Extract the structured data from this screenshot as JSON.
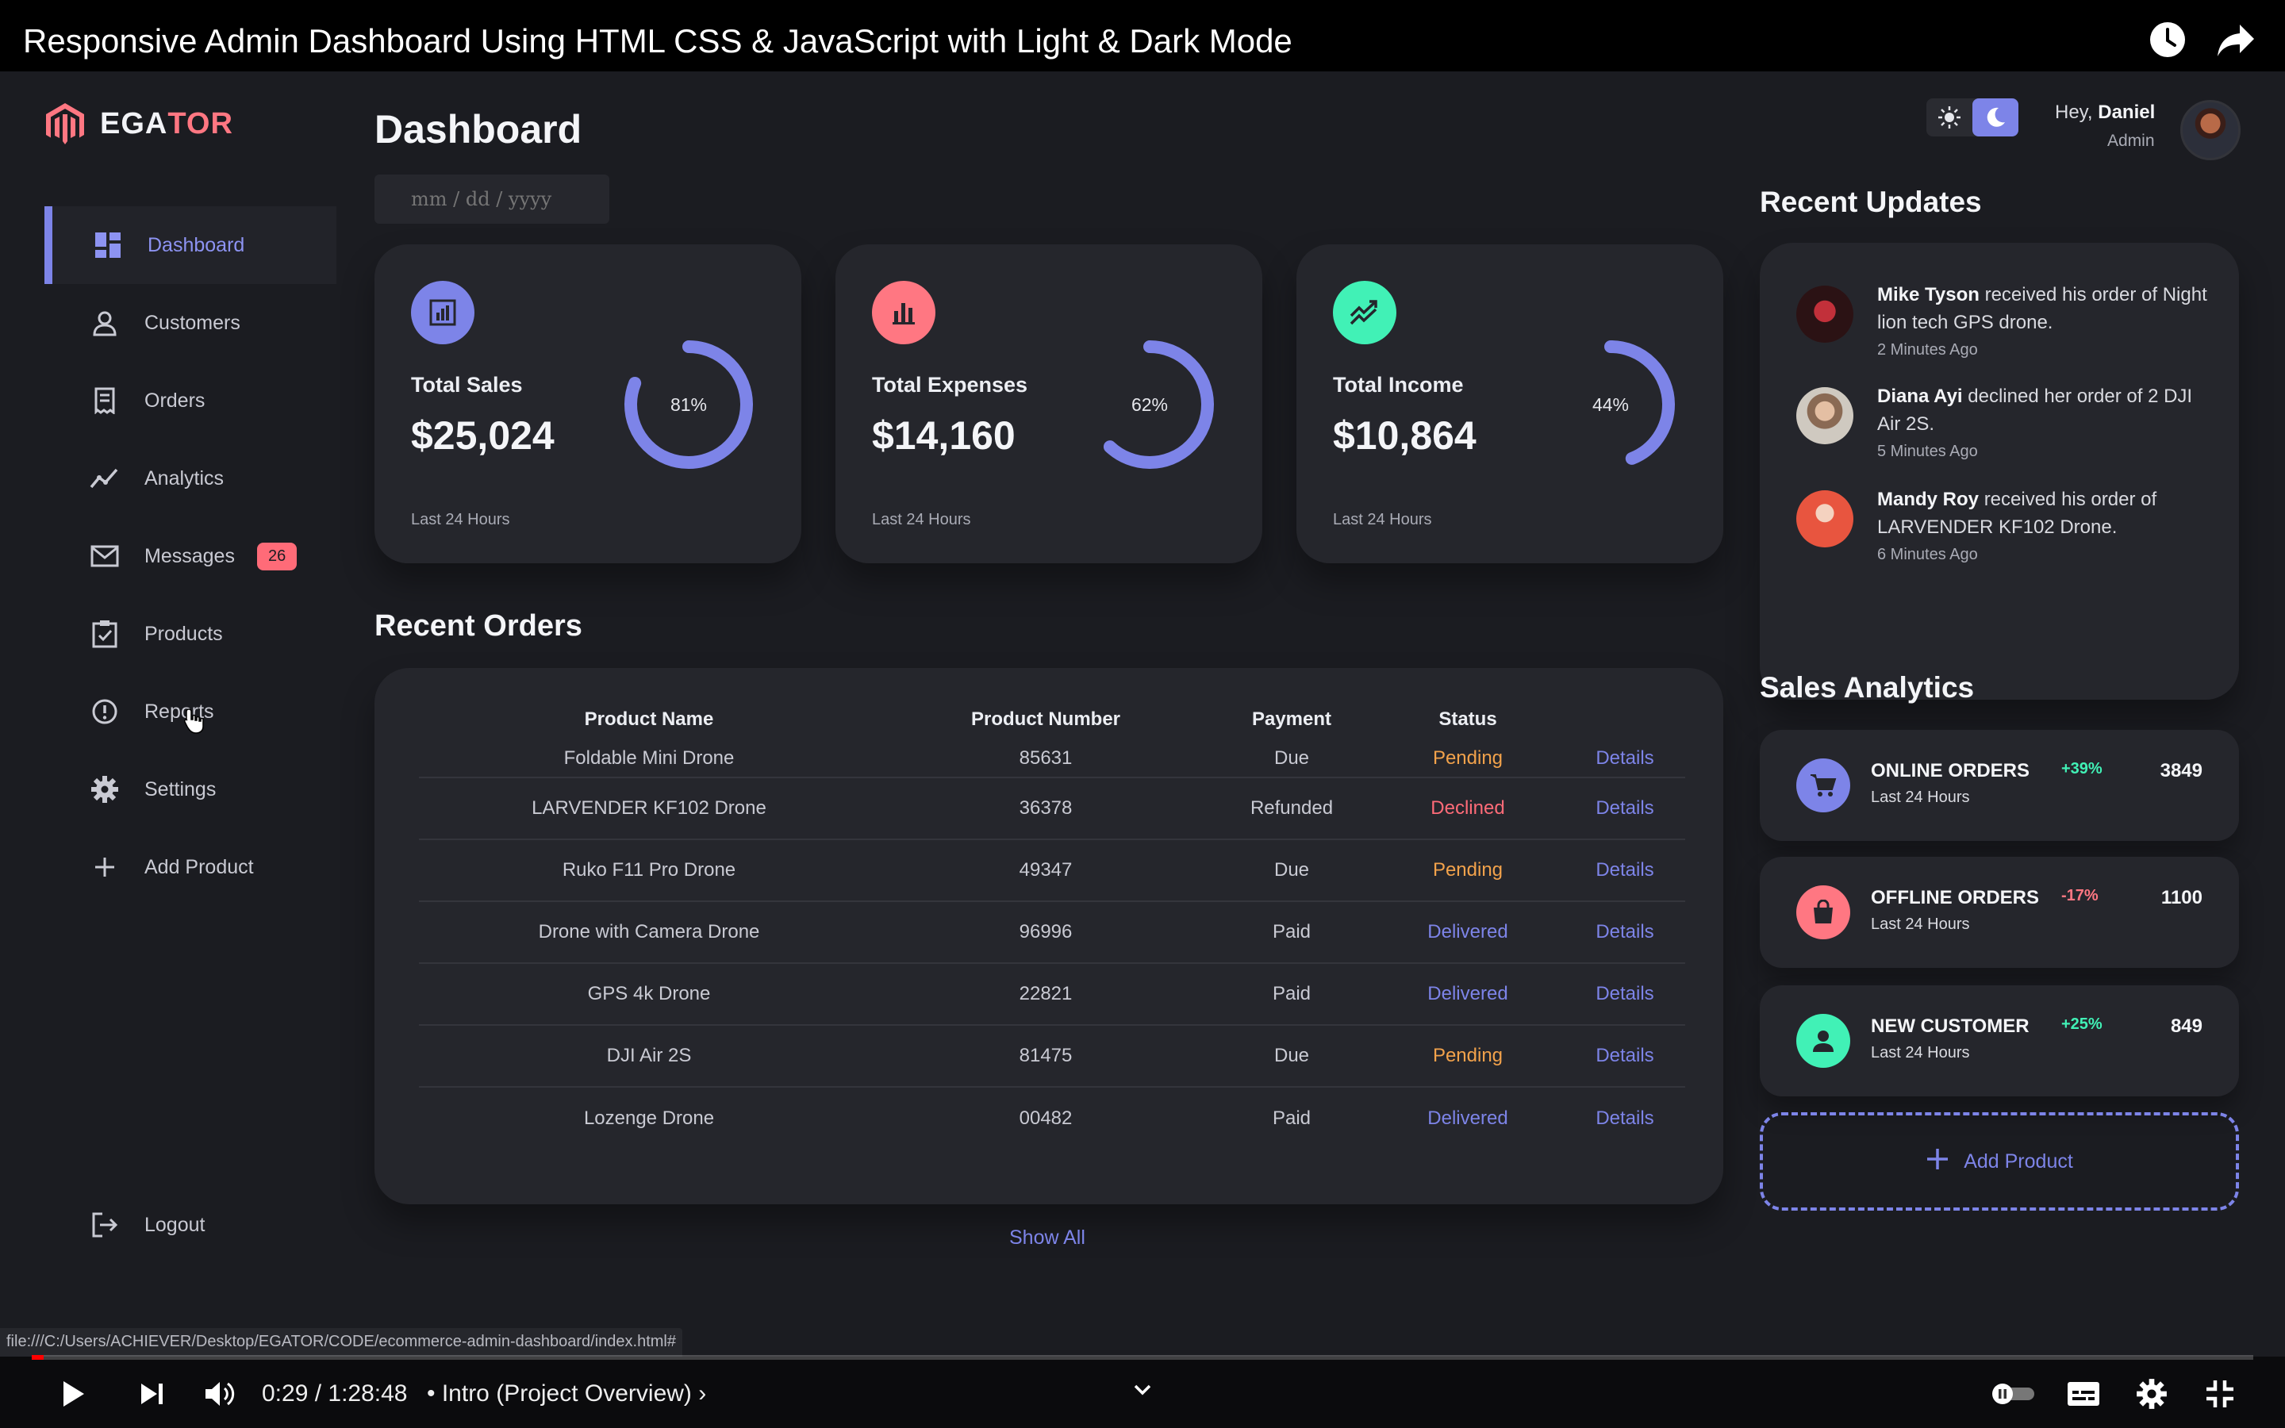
{
  "video": {
    "title": "Responsive Admin Dashboard Using HTML CSS & JavaScript with Light & Dark Mode",
    "time": "0:29 / 1:28:48",
    "chapter": "• Intro (Project Overview) ›",
    "progress_fraction": 0.0055,
    "status_url": "file:///C:/Users/ACHIEVER/Desktop/EGATOR/CODE/ecommerce-admin-dashboard/index.html#"
  },
  "logo": {
    "prefix": "EGA",
    "suffix": "TOR"
  },
  "sidebar": {
    "items": [
      {
        "label": "Dashboard",
        "icon": "grid-icon"
      },
      {
        "label": "Customers",
        "icon": "person-icon"
      },
      {
        "label": "Orders",
        "icon": "receipt-icon"
      },
      {
        "label": "Analytics",
        "icon": "trend-icon"
      },
      {
        "label": "Messages",
        "icon": "mail-icon",
        "badge": "26"
      },
      {
        "label": "Products",
        "icon": "clipboard-icon"
      },
      {
        "label": "Reports",
        "icon": "report-icon"
      },
      {
        "label": "Settings",
        "icon": "gear-icon"
      },
      {
        "label": "Add Product",
        "icon": "plus-icon"
      }
    ],
    "logout": "Logout"
  },
  "header": {
    "title": "Dashboard",
    "date_placeholder": "mm / dd / yyyy",
    "greeting": "Hey,",
    "user_name": "Daniel",
    "user_role": "Admin"
  },
  "cards": [
    {
      "label": "Total Sales",
      "value": "$25,024",
      "percent": "81%",
      "fraction": 0.81,
      "sub": "Last 24 Hours",
      "icon_color": "#7d84e8"
    },
    {
      "label": "Total Expenses",
      "value": "$14,160",
      "percent": "62%",
      "fraction": 0.62,
      "sub": "Last 24 Hours",
      "icon_color": "#ff7782"
    },
    {
      "label": "Total Income",
      "value": "$10,864",
      "percent": "44%",
      "fraction": 0.44,
      "sub": "Last 24 Hours",
      "icon_color": "#41f1b6"
    }
  ],
  "orders": {
    "title": "Recent Orders",
    "columns": [
      "Product Name",
      "Product Number",
      "Payment",
      "Status",
      ""
    ],
    "rows": [
      [
        "Foldable Mini Drone",
        "85631",
        "Due",
        "Pending",
        "Details"
      ],
      [
        "LARVENDER KF102 Drone",
        "36378",
        "Refunded",
        "Declined",
        "Details"
      ],
      [
        "Ruko F11 Pro Drone",
        "49347",
        "Due",
        "Pending",
        "Details"
      ],
      [
        "Drone with Camera Drone",
        "96996",
        "Paid",
        "Delivered",
        "Details"
      ],
      [
        "GPS 4k Drone",
        "22821",
        "Paid",
        "Delivered",
        "Details"
      ],
      [
        "DJI Air 2S",
        "81475",
        "Due",
        "Pending",
        "Details"
      ],
      [
        "Lozenge Drone",
        "00482",
        "Paid",
        "Delivered",
        "Details"
      ]
    ],
    "show_all": "Show All"
  },
  "updates": {
    "title": "Recent Updates",
    "items": [
      {
        "name": "Mike Tyson",
        "text": "received his order of Night lion tech GPS drone.",
        "time": "2 Minutes Ago"
      },
      {
        "name": "Diana Ayi",
        "text": "declined her order of 2 DJI Air 2S.",
        "time": "5 Minutes Ago"
      },
      {
        "name": "Mandy Roy",
        "text": "received his order of LARVENDER KF102 Drone.",
        "time": "6 Minutes Ago"
      }
    ]
  },
  "analytics": {
    "title": "Sales Analytics",
    "items": [
      {
        "name": "ONLINE ORDERS",
        "sub": "Last 24 Hours",
        "change": "+39%",
        "count": "3849",
        "color": "#7d84e8",
        "change_color": "#41f1b6",
        "icon": "cart-icon"
      },
      {
        "name": "OFFLINE ORDERS",
        "sub": "Last 24 Hours",
        "change": "-17%",
        "count": "1100",
        "color": "#ff7782",
        "change_color": "#ff7782",
        "icon": "bag-icon"
      },
      {
        "name": "NEW CUSTOMER",
        "sub": "Last 24 Hours",
        "change": "+25%",
        "count": "849",
        "color": "#41f1b6",
        "change_color": "#41f1b6",
        "icon": "person-icon"
      }
    ],
    "add_product": "Add Product"
  }
}
